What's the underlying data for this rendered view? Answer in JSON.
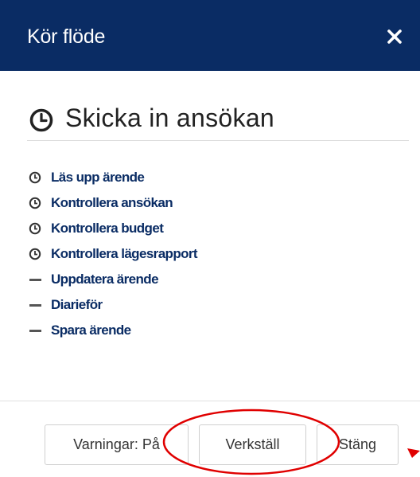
{
  "dialog": {
    "title": "Kör flöde",
    "close_icon": "close-icon"
  },
  "workflow": {
    "title": "Skicka in ansökan",
    "title_icon": "clock-icon",
    "steps": [
      {
        "label": "Läs upp ärende",
        "icon": "clock-icon"
      },
      {
        "label": "Kontrollera ansökan",
        "icon": "clock-icon"
      },
      {
        "label": "Kontrollera budget",
        "icon": "clock-icon"
      },
      {
        "label": "Kontrollera lägesrapport",
        "icon": "clock-icon"
      },
      {
        "label": "Uppdatera ärende",
        "icon": "dash-icon"
      },
      {
        "label": "Diarieför",
        "icon": "dash-icon"
      },
      {
        "label": "Spara ärende",
        "icon": "dash-icon"
      }
    ]
  },
  "footer": {
    "warnings_label": "Varningar: På",
    "apply_label": "Verkställ",
    "close_label": "Stäng"
  },
  "colors": {
    "header_bg": "#0a2c64",
    "link": "#0a2c64",
    "annotation": "#e00000"
  }
}
